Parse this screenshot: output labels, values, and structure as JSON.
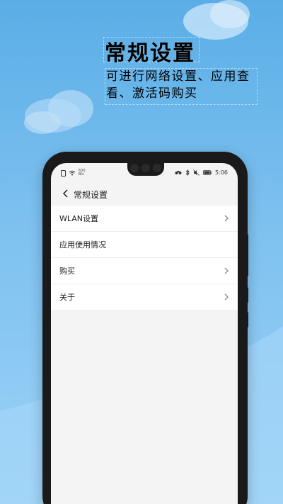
{
  "promo": {
    "title": "常规设置",
    "subtitle": "可进行网络设置、应用查看、激活码购买"
  },
  "status_bar": {
    "net_speed": "630",
    "net_unit": "B/s",
    "time": "5:06"
  },
  "app_bar": {
    "title": "常规设置"
  },
  "settings": {
    "items": [
      {
        "label": "WLAN设置",
        "has_chevron": true
      },
      {
        "label": "应用使用情况",
        "has_chevron": false
      },
      {
        "label": "购买",
        "has_chevron": true
      },
      {
        "label": "关于",
        "has_chevron": true
      }
    ]
  },
  "colors": {
    "sky_top": "#5aaee6",
    "sky_bottom": "#9bd2f6",
    "phone_frame": "#1a1a1a",
    "screen_bg": "#f4f4f4"
  }
}
